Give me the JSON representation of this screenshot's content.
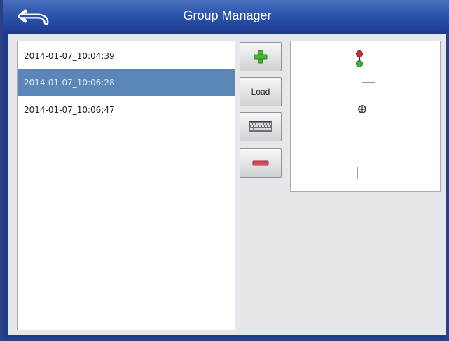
{
  "window": {
    "title": "Group Manager"
  },
  "header": {
    "back_icon": "back-arrow-icon"
  },
  "groups": {
    "items": [
      {
        "label": "2014-01-07_10:04:39",
        "selected": false
      },
      {
        "label": "2014-01-07_10:06:28",
        "selected": true
      },
      {
        "label": "2014-01-07_10:06:47",
        "selected": false
      }
    ]
  },
  "actions": {
    "add_icon": "plus-icon",
    "load_label": "Load",
    "rename_icon": "keyboard-icon",
    "delete_icon": "minus-icon"
  },
  "preview": {
    "icons": [
      "traffic-light-icon",
      "dash-icon",
      "crosshair-icon",
      "vertical-line-icon"
    ]
  },
  "colors": {
    "titlebar": "#2d57ad",
    "selected_row": "#5b86b8",
    "add": "#46b62c",
    "delete": "#e0455a"
  }
}
